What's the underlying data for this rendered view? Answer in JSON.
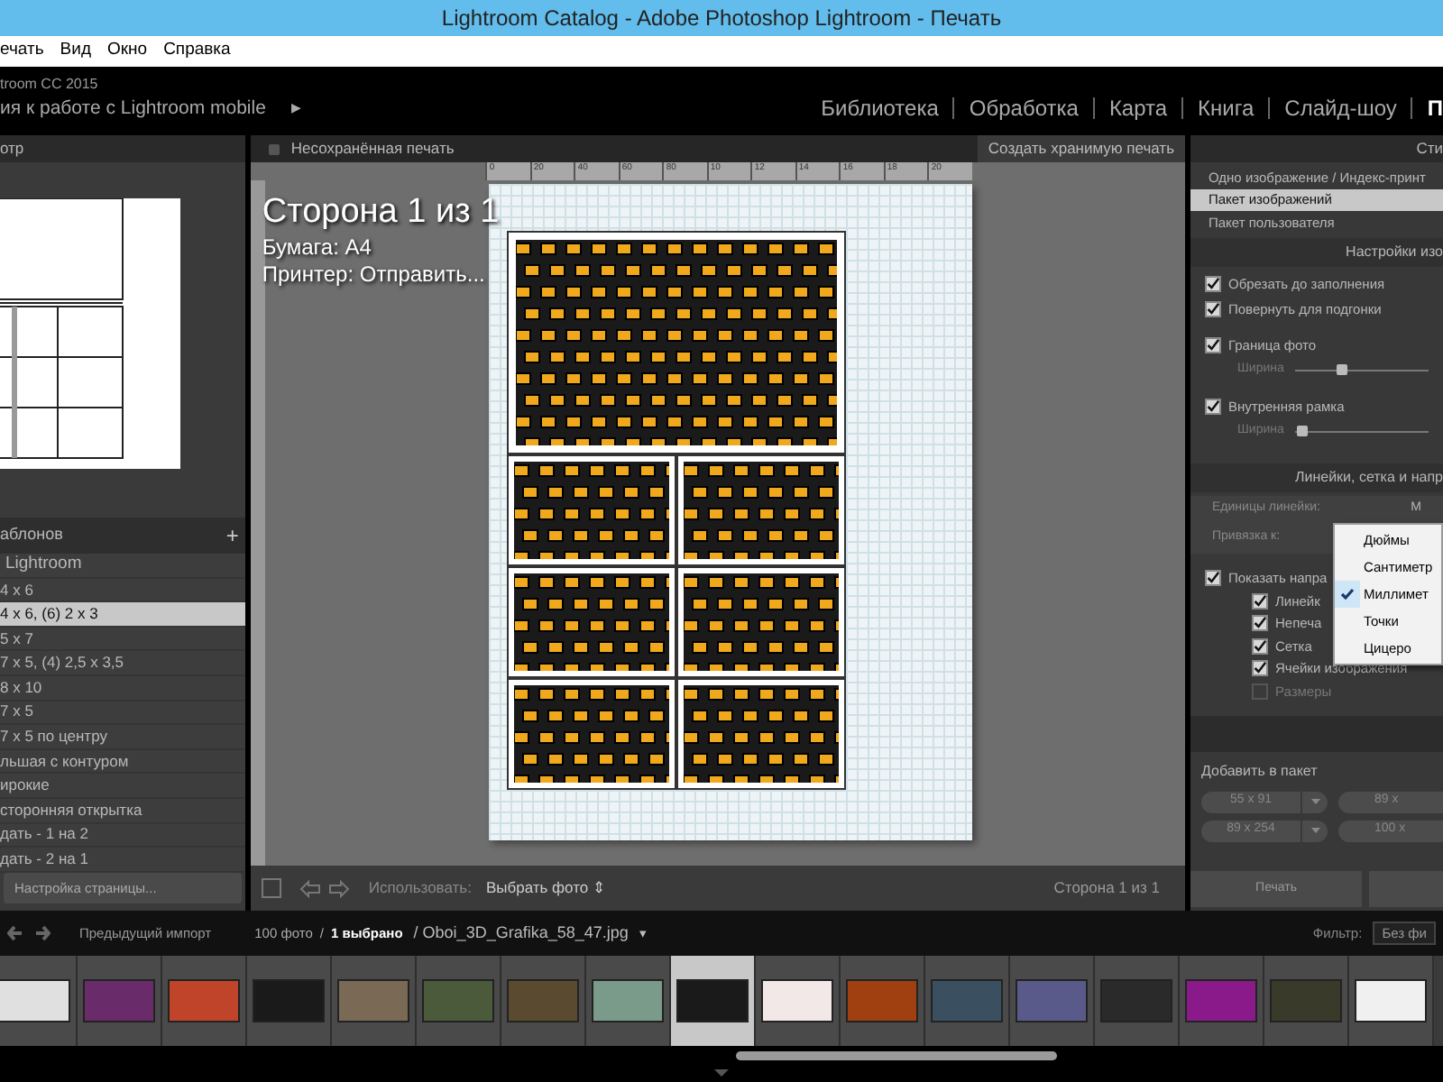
{
  "window": {
    "title": "Lightroom Catalog - Adobe Photoshop Lightroom - Печать"
  },
  "menu": [
    {
      "label": "ечать"
    },
    {
      "label": "Вид"
    },
    {
      "label": "Окно"
    },
    {
      "label": "Справка"
    }
  ],
  "identity": {
    "version": "troom CC 2015",
    "tagline": "ия к работе с Lightroom mobile",
    "arrow": "▶"
  },
  "modules": [
    {
      "label": "Библиотека",
      "selected": false
    },
    {
      "label": "Обработка",
      "selected": false
    },
    {
      "label": "Карта",
      "selected": false
    },
    {
      "label": "Книга",
      "selected": false
    },
    {
      "label": "Слайд-шоу",
      "selected": false
    },
    {
      "label": "П",
      "selected": true
    }
  ],
  "left_panel": {
    "preview_header": "отр",
    "templates_header": "аблонов",
    "add_icon": "+",
    "templates": [
      {
        "label": "Lightroom",
        "kind": "folder",
        "selected": false
      },
      {
        "label": "4 x 6",
        "kind": "item",
        "selected": false
      },
      {
        "label": "4 x 6, (6) 2 x 3",
        "kind": "item",
        "selected": true
      },
      {
        "label": "5 x 7",
        "kind": "item",
        "selected": false
      },
      {
        "label": "7 x 5, (4) 2,5 x 3,5",
        "kind": "item",
        "selected": false
      },
      {
        "label": "8 x 10",
        "kind": "item",
        "selected": false
      },
      {
        "label": "7 x 5",
        "kind": "item",
        "selected": false
      },
      {
        "label": "7 x 5 по центру",
        "kind": "item",
        "selected": false
      },
      {
        "label": "льшая с контуром",
        "kind": "item",
        "selected": false
      },
      {
        "label": "ирокие",
        "kind": "item",
        "selected": false
      },
      {
        "label": "сторонняя открытка",
        "kind": "item",
        "selected": false
      },
      {
        "label": "дать - 1 на 2",
        "kind": "item",
        "selected": false
      },
      {
        "label": "дать - 2 на 1",
        "kind": "item",
        "selected": false
      }
    ],
    "page_setup_button": "Настройка страницы..."
  },
  "center": {
    "toolbar_title": "Несохранённая печать",
    "save_button": "Создать хранимую печать",
    "ruler_labels": [
      "0",
      "20",
      "40",
      "60",
      "80",
      "10",
      "12",
      "14",
      "16",
      "18",
      "20"
    ],
    "overlay": {
      "page": "Сторона 1 из 1",
      "paper": "Бумага: A4",
      "printer": "Принтер: Отправить..."
    },
    "bottom": {
      "checked": false,
      "use_label": "Использовать:",
      "use_value": "Выбрать фото ⇕",
      "page_count": "Сторона 1 из 1"
    }
  },
  "right_panel": {
    "layout_header": "Сти",
    "layout_styles": [
      {
        "label": "Одно изображение / Индекс-принт",
        "selected": false
      },
      {
        "label": "Пакет изображений",
        "selected": true
      },
      {
        "label": "Пакет пользователя",
        "selected": false
      }
    ],
    "image_settings_header": "Настройки изо",
    "image_options": [
      {
        "kind": "checkbox",
        "label": "Обрезать до заполнения",
        "checked": true
      },
      {
        "kind": "checkbox",
        "label": "Повернуть для подгонки",
        "checked": true
      },
      {
        "kind": "checkbox",
        "label": "Граница фото",
        "checked": true
      },
      {
        "kind": "slider",
        "label": "Ширина",
        "level": 0.35
      },
      {
        "kind": "checkbox",
        "label": "Внутренняя рамка",
        "checked": true
      },
      {
        "kind": "slider",
        "label": "Ширина",
        "level": 0.05
      }
    ],
    "rulers_header": "Линейки, сетка и напр",
    "ruler_units_label": "Единицы линейки:",
    "ruler_units_value": "М",
    "snap_label": "Привязка к:",
    "guides": {
      "label": "Показать напра",
      "checked": true,
      "children": [
        {
          "label": "Линейк",
          "checked": true
        },
        {
          "label": "Непеча",
          "checked": true
        },
        {
          "label": "Сетка",
          "checked": true
        },
        {
          "label": "Ячейки изображения",
          "checked": true
        },
        {
          "label": "Размеры",
          "checked": false
        }
      ]
    },
    "units_menu": [
      {
        "label": "Дюймы",
        "checked": false
      },
      {
        "label": "Сантиметр",
        "checked": false
      },
      {
        "label": "Миллимет",
        "checked": true
      },
      {
        "label": "Точки",
        "checked": false
      },
      {
        "label": "Цицеро",
        "checked": false
      }
    ],
    "add_to_package_label": "Добавить в пакет",
    "size_buttons": [
      {
        "label": "55 x 91"
      },
      {
        "label": "89 x"
      },
      {
        "label": "89 x 254"
      },
      {
        "label": "100 x"
      }
    ],
    "print_button": "Печать"
  },
  "filmstrip": {
    "source": "Предыдущий импорт",
    "count": "100 фото",
    "separator": "/",
    "selected_count": "1 выбрано",
    "file": "/ Oboi_3D_Grafika_58_47.jpg",
    "caret": "▾",
    "filter_label": "Фильтр:",
    "filter_value": "Без фи",
    "thumbnails": [
      {
        "selected": false
      },
      {
        "selected": false
      },
      {
        "selected": false
      },
      {
        "selected": false
      },
      {
        "selected": false
      },
      {
        "selected": false
      },
      {
        "selected": false
      },
      {
        "selected": false
      },
      {
        "selected": true
      },
      {
        "selected": false
      },
      {
        "selected": false
      },
      {
        "selected": false
      },
      {
        "selected": false
      },
      {
        "selected": false
      },
      {
        "selected": false
      },
      {
        "selected": false
      },
      {
        "selected": false
      }
    ]
  }
}
